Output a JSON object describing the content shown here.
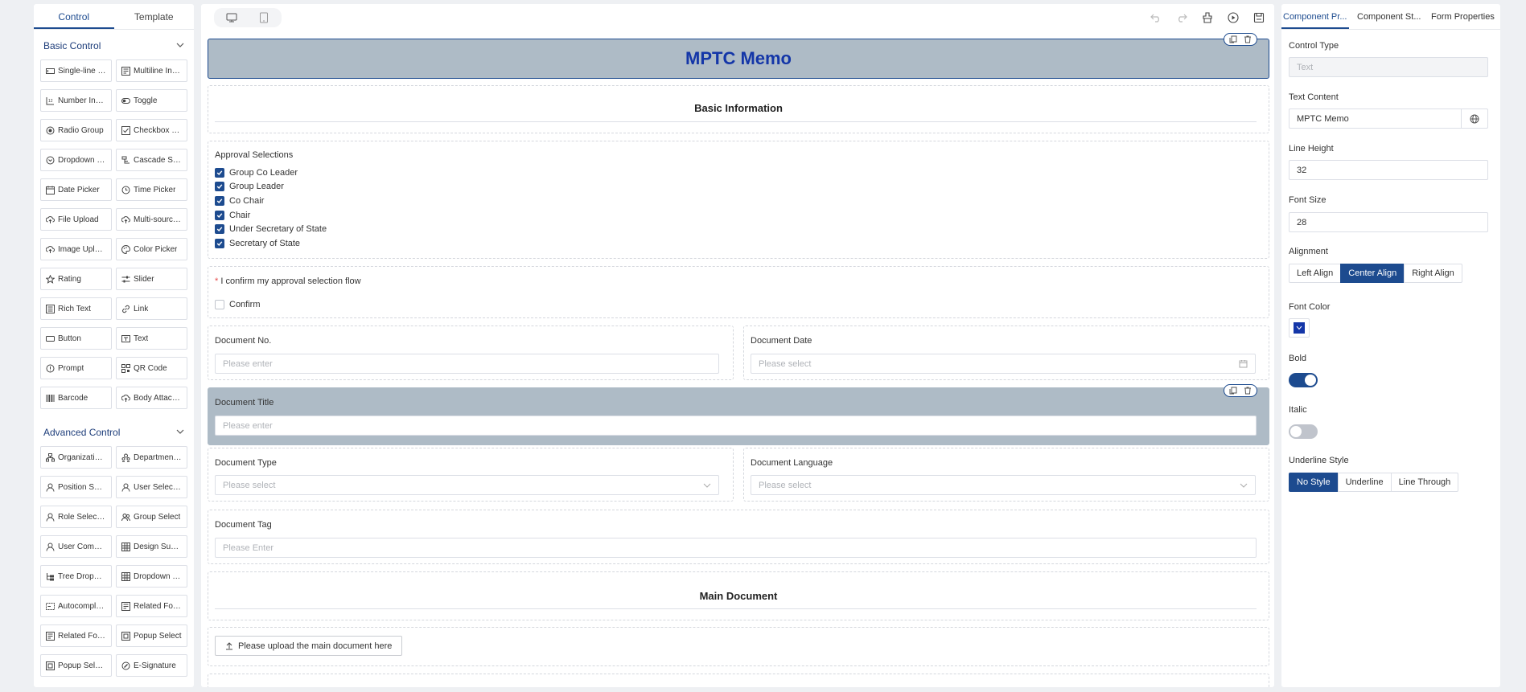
{
  "left_panel": {
    "tabs": [
      {
        "label": "Control",
        "active": true
      },
      {
        "label": "Template",
        "active": false
      }
    ],
    "basic_section": "Basic Control",
    "basic_controls": [
      {
        "label": "Single-line In...",
        "icon": "single-line-icon"
      },
      {
        "label": "Multiline Input",
        "icon": "multiline-icon"
      },
      {
        "label": "Number Input",
        "icon": "number-icon"
      },
      {
        "label": "Toggle",
        "icon": "toggle-icon"
      },
      {
        "label": "Radio Group",
        "icon": "radio-icon"
      },
      {
        "label": "Checkbox Gr...",
        "icon": "checkbox-icon"
      },
      {
        "label": "Dropdown Se...",
        "icon": "dropdown-icon"
      },
      {
        "label": "Cascade Select",
        "icon": "cascade-icon"
      },
      {
        "label": "Date Picker",
        "icon": "calendar-icon"
      },
      {
        "label": "Time Picker",
        "icon": "clock-icon"
      },
      {
        "label": "File Upload",
        "icon": "upload-icon"
      },
      {
        "label": "Multi-source ...",
        "icon": "upload-icon"
      },
      {
        "label": "Image Upload",
        "icon": "upload-icon"
      },
      {
        "label": "Color Picker",
        "icon": "palette-icon"
      },
      {
        "label": "Rating",
        "icon": "star-icon"
      },
      {
        "label": "Slider",
        "icon": "slider-icon"
      },
      {
        "label": "Rich Text",
        "icon": "rich-text-icon"
      },
      {
        "label": "Link",
        "icon": "link-icon"
      },
      {
        "label": "Button",
        "icon": "button-icon"
      },
      {
        "label": "Text",
        "icon": "text-icon"
      },
      {
        "label": "Prompt",
        "icon": "info-icon"
      },
      {
        "label": "QR Code",
        "icon": "qr-icon"
      },
      {
        "label": "Barcode",
        "icon": "barcode-icon"
      },
      {
        "label": "Body Attach...",
        "icon": "upload-icon"
      }
    ],
    "advanced_section": "Advanced Control",
    "advanced_controls": [
      {
        "label": "Organization ...",
        "icon": "org-icon"
      },
      {
        "label": "Department S...",
        "icon": "department-icon"
      },
      {
        "label": "Position Selec...",
        "icon": "user-icon"
      },
      {
        "label": "User Selection",
        "icon": "user-icon"
      },
      {
        "label": "Role Selection",
        "icon": "user-icon"
      },
      {
        "label": "Group Select",
        "icon": "group-icon"
      },
      {
        "label": "User Compon...",
        "icon": "user-icon"
      },
      {
        "label": "Design Subta...",
        "icon": "table-icon"
      },
      {
        "label": "Tree Dropdown",
        "icon": "tree-icon"
      },
      {
        "label": "Dropdown Ta...",
        "icon": "table-icon"
      },
      {
        "label": "Autocomplete",
        "icon": "autocomplete-icon"
      },
      {
        "label": "Related Form",
        "icon": "form-icon"
      },
      {
        "label": "Related Form...",
        "icon": "form-icon"
      },
      {
        "label": "Popup Select",
        "icon": "popup-icon"
      },
      {
        "label": "Popup Select ...",
        "icon": "popup-icon"
      },
      {
        "label": "E-Signature",
        "icon": "signature-icon"
      }
    ]
  },
  "canvas": {
    "title": "MPTC Memo",
    "basic_info_title": "Basic Information",
    "approval": {
      "label": "Approval Selections",
      "options": [
        "Group Co Leader",
        "Group Leader",
        "Co Chair",
        "Chair",
        "Under Secretary of State",
        "Secretary of State"
      ]
    },
    "confirm": {
      "required_mark": "*",
      "label": "I confirm my approval selection flow",
      "checkbox_label": "Confirm"
    },
    "doc_no": {
      "label": "Document No.",
      "placeholder": "Please enter"
    },
    "doc_date": {
      "label": "Document Date",
      "placeholder": "Please select"
    },
    "doc_title": {
      "label": "Document Title",
      "placeholder": "Please enter"
    },
    "doc_type": {
      "label": "Document Type",
      "placeholder": "Please select"
    },
    "doc_language": {
      "label": "Document Language",
      "placeholder": "Please select"
    },
    "doc_tag": {
      "label": "Document Tag",
      "placeholder": "Please Enter"
    },
    "main_doc_title": "Main Document",
    "upload_label": "Please upload the main document here"
  },
  "right_panel": {
    "tabs": [
      {
        "label": "Component Pr...",
        "active": true
      },
      {
        "label": "Component St...",
        "active": false
      },
      {
        "label": "Form Properties",
        "active": false
      }
    ],
    "control_type_label": "Control Type",
    "control_type_value": "Text",
    "text_content_label": "Text Content",
    "text_content_value": "MPTC Memo",
    "line_height_label": "Line Height",
    "line_height_value": "32",
    "font_size_label": "Font Size",
    "font_size_value": "28",
    "alignment_label": "Alignment",
    "alignment_options": [
      {
        "label": "Left Align",
        "active": false
      },
      {
        "label": "Center Align",
        "active": true
      },
      {
        "label": "Right Align",
        "active": false
      }
    ],
    "font_color_label": "Font Color",
    "font_color_value": "#1436a8",
    "bold_label": "Bold",
    "bold_on": true,
    "italic_label": "Italic",
    "italic_on": false,
    "underline_label": "Underline Style",
    "underline_options": [
      {
        "label": "No Style",
        "active": true
      },
      {
        "label": "Underline",
        "active": false
      },
      {
        "label": "Line Through",
        "active": false
      }
    ]
  },
  "colors": {
    "accent": "#1d4b8f",
    "title_text": "#1436a8",
    "selected_block_bg": "#aebbc6",
    "page_bg": "#eef0f3"
  }
}
